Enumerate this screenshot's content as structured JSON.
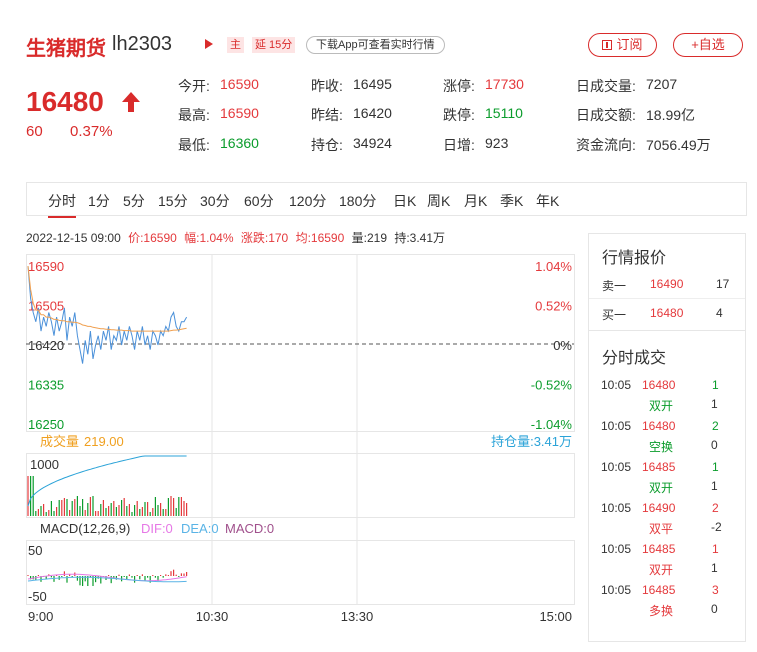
{
  "header": {
    "title": "生猪期货",
    "code": "lh2303",
    "tag_main": "主",
    "tag_delay": "延 15分",
    "download_label": "下载App可查看实时行情",
    "subscribe_label": "订阅",
    "favorite_label": "+自选"
  },
  "price": {
    "last": "16480",
    "change": "60",
    "change_pct": "0.37%"
  },
  "stats": [
    {
      "label": "今开:",
      "value": "16590",
      "tone": "red"
    },
    {
      "label": "昨收:",
      "value": "16495",
      "tone": "neutral"
    },
    {
      "label": "涨停:",
      "value": "17730",
      "tone": "red"
    },
    {
      "label": "日成交量:",
      "value": "7207",
      "tone": "neutral"
    },
    {
      "label": "最高:",
      "value": "16590",
      "tone": "red"
    },
    {
      "label": "昨结:",
      "value": "16420",
      "tone": "neutral"
    },
    {
      "label": "跌停:",
      "value": "15110",
      "tone": "green"
    },
    {
      "label": "日成交额:",
      "value": "18.99亿",
      "tone": "neutral"
    },
    {
      "label": "最低:",
      "value": "16360",
      "tone": "green"
    },
    {
      "label": "持仓:",
      "value": "34924",
      "tone": "neutral"
    },
    {
      "label": "日增:",
      "value": "923",
      "tone": "neutral"
    },
    {
      "label": "资金流向:",
      "value": "7056.49万",
      "tone": "neutral"
    }
  ],
  "tabs": [
    "分时",
    "1分",
    "5分",
    "15分",
    "30分",
    "60分",
    "120分",
    "180分",
    "日K",
    "周K",
    "月K",
    "季K",
    "年K"
  ],
  "active_tab": "分时",
  "info_line": {
    "datetime": "2022-12-15 09:00",
    "price": "价:16590",
    "amplitude": "幅:1.04%",
    "change": "涨跌:170",
    "average": "均:16590",
    "volume": "量:219",
    "open_interest": "持:3.41万"
  },
  "chart_data": {
    "type": "line",
    "price_axis": {
      "left_ticks": [
        "16590",
        "16505",
        "16420",
        "16335",
        "16250"
      ],
      "right_ticks": [
        "1.04%",
        "0.52%",
        "0%",
        "-0.52%",
        "-1.04%"
      ],
      "ylim": [
        16250,
        16590
      ]
    },
    "time_ticks": [
      "9:00",
      "10:30",
      "13:30",
      "15:00"
    ],
    "series": [
      {
        "name": "",
        "values": [
          16590,
          16520,
          16490,
          16470,
          16500,
          16450,
          16480,
          16460,
          16490,
          16470,
          16440,
          16480,
          16450,
          16470,
          16500,
          16430,
          16480,
          16460,
          16490,
          16440,
          16410,
          16380,
          16430,
          16400,
          16450,
          16390,
          16420,
          16440,
          16410,
          16450,
          16430,
          16460,
          16410,
          16440,
          16430,
          16460,
          16420,
          16450,
          16430,
          16460,
          16440,
          16410,
          16450,
          16430,
          16460,
          16420,
          16440,
          16410,
          16450,
          16440,
          16420,
          16450,
          16440,
          16460,
          16450,
          16480,
          16490,
          16460,
          16450,
          16470,
          16470,
          16480
        ]
      },
      {
        "name": "",
        "values": [
          16590,
          16540,
          16510,
          16495,
          16495,
          16485,
          16485,
          16480,
          16480,
          16478,
          16475,
          16475,
          16473,
          16472,
          16472,
          16470,
          16470,
          16469,
          16469,
          16468,
          16466,
          16463,
          16462,
          16460,
          16460,
          16458,
          16457,
          16456,
          16455,
          16455,
          16454,
          16454,
          16453,
          16453,
          16452,
          16452,
          16452,
          16451,
          16451,
          16451,
          16450,
          16450,
          16450,
          16450,
          16450,
          16450,
          16450,
          16450,
          16450,
          16450,
          16450,
          16450,
          16450,
          16450,
          16450,
          16451,
          16452,
          16452,
          16453,
          16454,
          16455,
          16456
        ]
      }
    ],
    "volume_panel": {
      "label": "成交量",
      "value": "219.00",
      "oi_label": "持仓量:3.41万",
      "tick": "1000",
      "color_up": "#e4393c",
      "color_down": "#0b9c2c",
      "oi_color": "#2ba3d8"
    },
    "macd_panel": {
      "label": "MACD(12,26,9)",
      "dif": "DIF:0",
      "dea": "DEA:0",
      "macd": "MACD:0",
      "ticks": [
        "50",
        "-50"
      ],
      "dif_color": "#e678e6",
      "dea_color": "#5ab4e6",
      "macd_color": "#a0508c"
    }
  },
  "quote_panel": {
    "title": "行情报价",
    "rows": [
      {
        "side": "卖一",
        "price": "16490",
        "qty": "17"
      },
      {
        "side": "买一",
        "price": "16480",
        "qty": "4"
      }
    ]
  },
  "trades_panel": {
    "title": "分时成交",
    "rows": [
      {
        "time": "10:05",
        "price": "16480",
        "qty": "1",
        "type": "双开",
        "change": "1",
        "tone": "green"
      },
      {
        "time": "10:05",
        "price": "16480",
        "qty": "2",
        "type": "空换",
        "change": "0",
        "tone": "green"
      },
      {
        "time": "10:05",
        "price": "16485",
        "qty": "1",
        "type": "双开",
        "change": "1",
        "tone": "green"
      },
      {
        "time": "10:05",
        "price": "16490",
        "qty": "2",
        "type": "双平",
        "change": "-2",
        "tone": "red"
      },
      {
        "time": "10:05",
        "price": "16485",
        "qty": "1",
        "type": "双开",
        "change": "1",
        "tone": "red"
      },
      {
        "time": "10:05",
        "price": "16485",
        "qty": "3",
        "type": "多换",
        "change": "0",
        "tone": "red"
      }
    ]
  },
  "colors": {
    "brand": "#d92b2b",
    "up": "#e4393c",
    "down": "#0b9c2c",
    "price_line": "#4a90d9",
    "avg_line": "#f0a050"
  }
}
